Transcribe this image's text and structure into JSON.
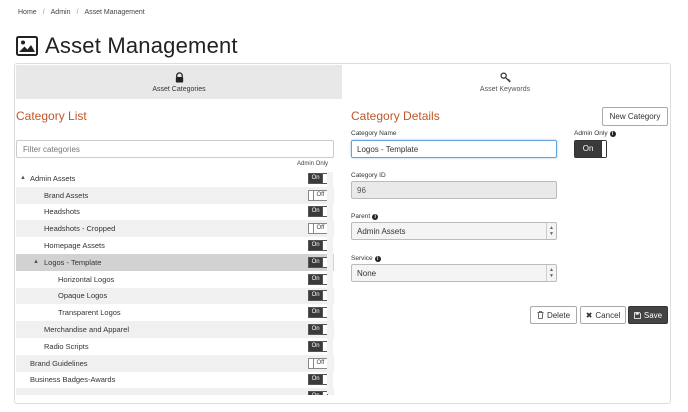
{
  "breadcrumb": [
    "Home",
    "Admin",
    "Asset Management"
  ],
  "breadcrumb_separator": "/",
  "page": {
    "title": "Asset Management",
    "icon": "image-icon"
  },
  "tabs": [
    {
      "label": "Asset Categories",
      "icon": "lock-icon",
      "active": true
    },
    {
      "label": "Asset Keywords",
      "icon": "key-icon",
      "active": false
    }
  ],
  "category_list": {
    "title": "Category List",
    "filter_placeholder": "Filter categories",
    "admin_only_header": "Admin Only",
    "items": [
      {
        "label": "Admin Assets",
        "level": 0,
        "toggle": "▲",
        "admin_only": "On"
      },
      {
        "label": "Brand Assets",
        "level": 1,
        "toggle": "",
        "admin_only": "Off"
      },
      {
        "label": "Headshots",
        "level": 1,
        "toggle": "",
        "admin_only": "On"
      },
      {
        "label": "Headshots - Cropped",
        "level": 1,
        "toggle": "",
        "admin_only": "Off"
      },
      {
        "label": "Homepage Assets",
        "level": 1,
        "toggle": "",
        "admin_only": "On"
      },
      {
        "label": "Logos - Template",
        "level": 1,
        "toggle": "▲",
        "admin_only": "On",
        "selected": true
      },
      {
        "label": "Horizontal Logos",
        "level": 2,
        "toggle": "",
        "admin_only": "On"
      },
      {
        "label": "Opaque Logos",
        "level": 2,
        "toggle": "",
        "admin_only": "On"
      },
      {
        "label": "Transparent Logos",
        "level": 2,
        "toggle": "",
        "admin_only": "On"
      },
      {
        "label": "Merchandise and Apparel",
        "level": 1,
        "toggle": "",
        "admin_only": "On"
      },
      {
        "label": "Radio Scripts",
        "level": 1,
        "toggle": "",
        "admin_only": "On"
      },
      {
        "label": "Brand Guidelines",
        "level": 0,
        "toggle": "",
        "admin_only": "Off"
      },
      {
        "label": "Business Badges-Awards",
        "level": 0,
        "toggle": "",
        "admin_only": "On"
      },
      {
        "label": "",
        "level": 0,
        "toggle": "",
        "admin_only": "On"
      }
    ]
  },
  "category_details": {
    "title": "Category Details",
    "new_button": "New Category",
    "name_label": "Category Name",
    "name_value": "Logos - Template",
    "admin_only_label": "Admin Only",
    "admin_only_value": "On",
    "id_label": "Category ID",
    "id_value": "96",
    "parent_label": "Parent",
    "parent_value": "Admin Assets",
    "service_label": "Service",
    "service_value": "None",
    "delete_button": "Delete",
    "cancel_button": "Cancel",
    "save_button": "Save"
  },
  "colors": {
    "section_title": "#c0572a",
    "switch_on": "#3a3a3a",
    "active_tab": "#e8e8e8",
    "selected_row": "#d2d2d2"
  }
}
